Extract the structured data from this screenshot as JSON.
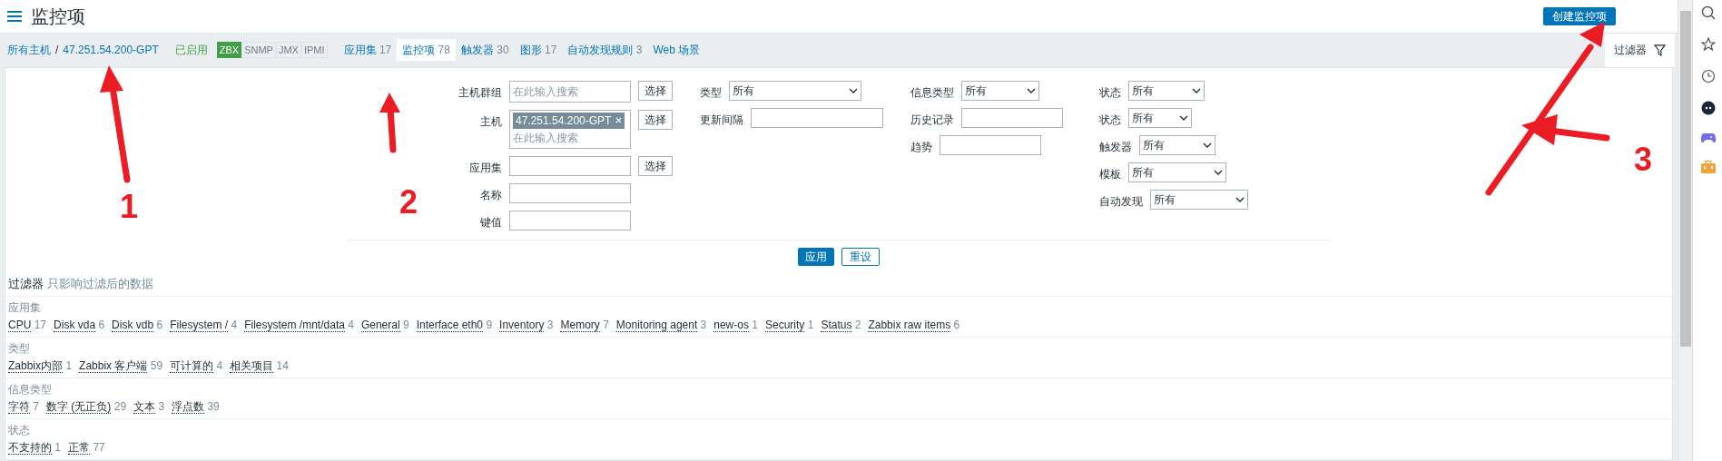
{
  "header": {
    "title": "监控项",
    "create_button": "创建监控项"
  },
  "nav": {
    "breadcrumbs": [
      "所有主机",
      "47.251.54.200-GPT"
    ],
    "separator": "/",
    "status": "已启用",
    "availability": [
      {
        "label": "ZBX",
        "active": true
      },
      {
        "label": "SNMP",
        "active": false
      },
      {
        "label": "JMX",
        "active": false
      },
      {
        "label": "IPMI",
        "active": false
      }
    ],
    "tabs": [
      {
        "label": "应用集",
        "count": "17",
        "selected": false
      },
      {
        "label": "监控项",
        "count": "78",
        "selected": true
      },
      {
        "label": "触发器",
        "count": "30",
        "selected": false
      },
      {
        "label": "图形",
        "count": "17",
        "selected": false
      },
      {
        "label": "自动发现规则",
        "count": "3",
        "selected": false
      },
      {
        "label": "Web 场景",
        "selected": false
      }
    ],
    "filter_toggle": "过滤器"
  },
  "filter": {
    "columns": [
      [
        {
          "kind": "multiselect",
          "label": "主机群组",
          "placeholder": "在此输入搜索",
          "button": "选择"
        },
        {
          "kind": "multiselect",
          "label": "主机",
          "chips": [
            "47.251.54.200-GPT"
          ],
          "placeholder": "在此输入搜索",
          "button": "选择"
        },
        {
          "kind": "text",
          "label": "应用集",
          "button": "选择"
        },
        {
          "kind": "text",
          "label": "名称"
        },
        {
          "kind": "text",
          "label": "键值"
        }
      ],
      [
        {
          "kind": "select",
          "label": "类型",
          "value": "所有"
        },
        {
          "kind": "text",
          "label": "更新间隔"
        }
      ],
      [
        {
          "kind": "select",
          "label": "信息类型",
          "value": "所有"
        },
        {
          "kind": "text",
          "label": "历史记录"
        },
        {
          "kind": "text",
          "label": "趋势"
        }
      ],
      [
        {
          "kind": "select",
          "label": "状态",
          "value": "所有"
        },
        {
          "kind": "select",
          "label": "状态",
          "value": "所有"
        },
        {
          "kind": "select",
          "label": "触发器",
          "value": "所有"
        },
        {
          "kind": "select",
          "label": "模板",
          "value": "所有"
        },
        {
          "kind": "select",
          "label": "自动发现",
          "value": "所有"
        }
      ]
    ],
    "apply_button": "应用",
    "reset_button": "重设"
  },
  "subfilter": {
    "title": "过滤器",
    "note": "只影响过滤后的数据",
    "groups": [
      {
        "title": "应用集",
        "items": [
          {
            "label": "CPU",
            "count": "17"
          },
          {
            "label": "Disk vda",
            "count": "6"
          },
          {
            "label": "Disk vdb",
            "count": "6"
          },
          {
            "label": "Filesystem /",
            "count": "4"
          },
          {
            "label": "Filesystem /mnt/data",
            "count": "4"
          },
          {
            "label": "General",
            "count": "9"
          },
          {
            "label": "Interface eth0",
            "count": "9"
          },
          {
            "label": "Inventory",
            "count": "3"
          },
          {
            "label": "Memory",
            "count": "7"
          },
          {
            "label": "Monitoring agent",
            "count": "3"
          },
          {
            "label": "new-os",
            "count": "1"
          },
          {
            "label": "Security",
            "count": "1"
          },
          {
            "label": "Status",
            "count": "2"
          },
          {
            "label": "Zabbix raw items",
            "count": "6"
          }
        ]
      },
      {
        "title": "类型",
        "items": [
          {
            "label": "Zabbix内部",
            "count": "1"
          },
          {
            "label": "Zabbix 客户端",
            "count": "59"
          },
          {
            "label": "可计算的",
            "count": "4"
          },
          {
            "label": "相关项目",
            "count": "14"
          }
        ]
      },
      {
        "title": "信息类型",
        "items": [
          {
            "label": "字符",
            "count": "7"
          },
          {
            "label": "数字 (无正负)",
            "count": "29"
          },
          {
            "label": "文本",
            "count": "3"
          },
          {
            "label": "浮点数",
            "count": "39"
          }
        ]
      },
      {
        "title": "状态",
        "items": [
          {
            "label": "不支持的",
            "count": "1"
          },
          {
            "label": "正常",
            "count": "77"
          }
        ]
      }
    ]
  },
  "annotations": [
    {
      "label": "1"
    },
    {
      "label": "2"
    },
    {
      "label": "3"
    }
  ]
}
